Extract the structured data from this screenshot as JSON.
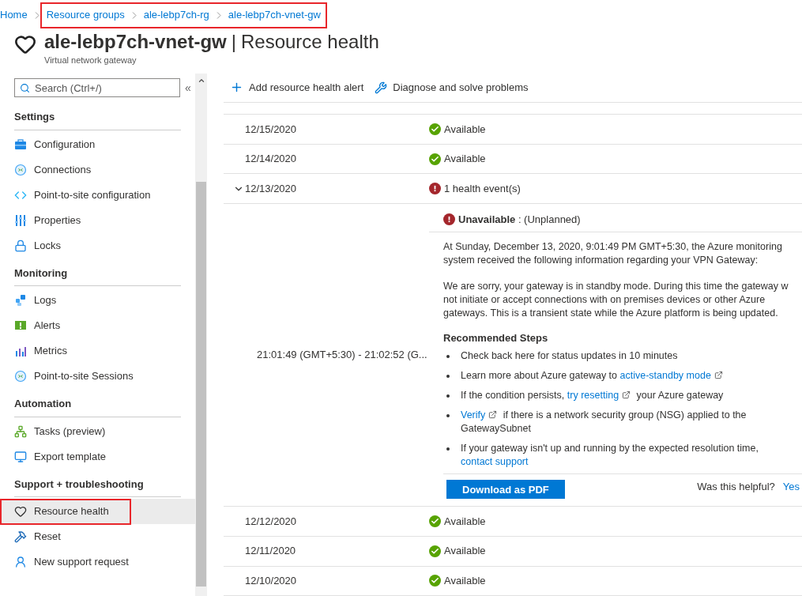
{
  "breadcrumb": [
    {
      "label": "Home",
      "annotated": false
    },
    {
      "label": "Resource groups",
      "annotated": true
    },
    {
      "label": "ale-lebp7ch-rg",
      "annotated": true
    },
    {
      "label": "ale-lebp7ch-vnet-gw",
      "annotated": true
    }
  ],
  "header": {
    "resource": "ale-lebp7ch-vnet-gw",
    "separator": "|",
    "page": "Resource health",
    "subtitle": "Virtual network gateway"
  },
  "sidebar": {
    "search": {
      "placeholder": "Search (Ctrl+/)"
    },
    "collapse": "«",
    "sections": [
      {
        "title": "Settings",
        "items": [
          {
            "label": "Configuration",
            "kind": "briefcase",
            "selected": false,
            "annotated": false
          },
          {
            "label": "Connections",
            "kind": "connection",
            "selected": false,
            "annotated": false
          },
          {
            "label": "Point-to-site configuration",
            "kind": "code",
            "selected": false,
            "annotated": false
          },
          {
            "label": "Properties",
            "kind": "bars",
            "selected": false,
            "annotated": false
          },
          {
            "label": "Locks",
            "kind": "lock",
            "selected": false,
            "annotated": false
          }
        ]
      },
      {
        "title": "Monitoring",
        "items": [
          {
            "label": "Logs",
            "kind": "logs",
            "selected": false,
            "annotated": false
          },
          {
            "label": "Alerts",
            "kind": "alert",
            "selected": false,
            "annotated": false
          },
          {
            "label": "Metrics",
            "kind": "chart",
            "selected": false,
            "annotated": false
          },
          {
            "label": "Point-to-site Sessions",
            "kind": "connection",
            "selected": false,
            "annotated": false
          }
        ]
      },
      {
        "title": "Automation",
        "items": [
          {
            "label": "Tasks (preview)",
            "kind": "tree",
            "selected": false,
            "annotated": false
          },
          {
            "label": "Export template",
            "kind": "monitor",
            "selected": false,
            "annotated": false
          }
        ]
      },
      {
        "title": "Support + troubleshooting",
        "items": [
          {
            "label": "Resource health",
            "kind": "heart",
            "selected": true,
            "annotated": true
          },
          {
            "label": "Reset",
            "kind": "hammer",
            "selected": false,
            "annotated": false
          },
          {
            "label": "New support request",
            "kind": "person",
            "selected": false,
            "annotated": false
          }
        ]
      }
    ]
  },
  "toolbar": [
    {
      "label": "Add resource health alert",
      "kind": "plus"
    },
    {
      "label": "Diagnose and solve problems",
      "kind": "wrench"
    }
  ],
  "rows": [
    {
      "date": "12/15/2020",
      "kind": "ok",
      "label": "Available",
      "expanded": false
    },
    {
      "date": "12/14/2020",
      "kind": "ok",
      "label": "Available",
      "expanded": false
    },
    {
      "date": "12/13/2020",
      "kind": "error",
      "label": "1 health event(s)",
      "expanded": true,
      "event": {
        "time": "21:01:49 (GMT+5:30) - 21:02:52 (G...",
        "state": "Unavailable",
        "note": " : (Unplanned)",
        "paragraphs": [
          [
            "At Sunday, December 13, 2020, 9:01:49 PM GMT+5:30, the Azure monitoring",
            "system received the following information regarding your VPN Gateway:"
          ],
          [
            "We are sorry, your gateway is in standby mode. During this time the gateway w",
            "not initiate or accept connections with on premises devices or other Azure",
            "gateways. This is a transient state while the Azure platform is being updated."
          ]
        ],
        "steps_title": "Recommended Steps",
        "steps": [
          [
            {
              "kind": "text",
              "text": "Check back here for status updates in 10 minutes"
            }
          ],
          [
            {
              "kind": "text",
              "text": "Learn more about Azure gateway to "
            },
            {
              "kind": "ext-link",
              "text": "active-standby mode"
            }
          ],
          [
            {
              "kind": "text",
              "text": "If the condition persists, "
            },
            {
              "kind": "ext-link",
              "text": "try resetting"
            },
            {
              "kind": "text",
              "text": " your Azure gateway"
            }
          ],
          [
            {
              "kind": "ext-link",
              "text": "Verify"
            },
            {
              "kind": "text",
              "text": " if there is a network security group (NSG) applied to the GatewaySubnet"
            }
          ],
          [
            {
              "kind": "text",
              "text": "If your gateway isn't up and running by the expected resolution time, "
            },
            {
              "kind": "link",
              "text": "contact support"
            }
          ]
        ],
        "download": "Download as PDF",
        "helpful": "Was this helpful?",
        "yes": "Yes"
      }
    },
    {
      "date": "12/12/2020",
      "kind": "ok",
      "label": "Available",
      "expanded": false
    },
    {
      "date": "12/11/2020",
      "kind": "ok",
      "label": "Available",
      "expanded": false
    },
    {
      "date": "12/10/2020",
      "kind": "ok",
      "label": "Available",
      "expanded": false
    }
  ]
}
